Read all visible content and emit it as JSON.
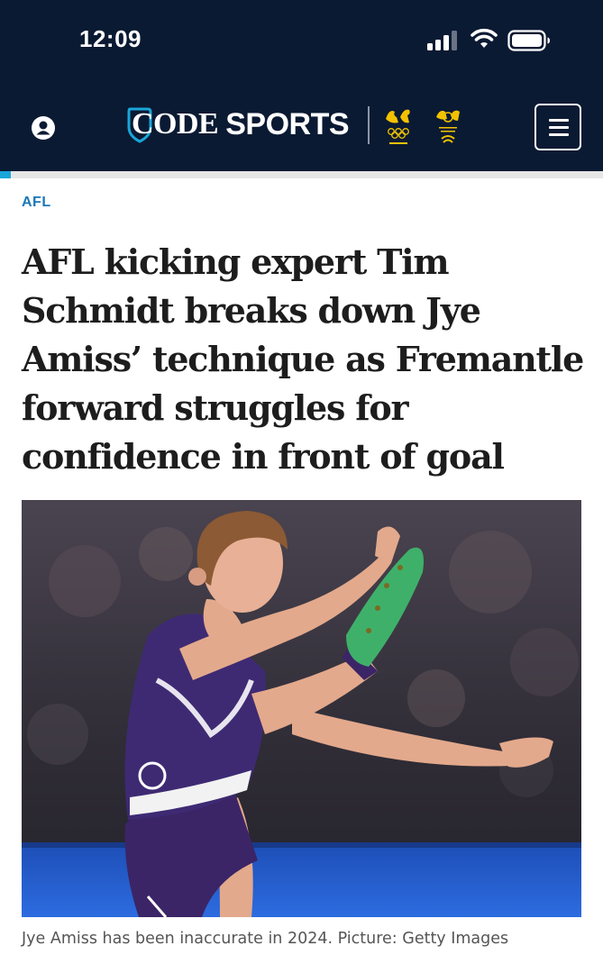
{
  "status_bar": {
    "time": "12:09",
    "icons": [
      "cellular-signal-icon",
      "wifi-icon",
      "battery-icon"
    ]
  },
  "header": {
    "logo_code": "CODE",
    "logo_sports": "SPORTS",
    "partner_logos": [
      "australian-olympic-team-logo",
      "paralympics-australia-logo"
    ],
    "colors": {
      "background": "#0b1a33",
      "accent": "#19a6d9"
    }
  },
  "article": {
    "category": "AFL",
    "headline": "AFL kicking expert Tim Schmidt breaks down Jye Amiss’ technique as Fremantle forward struggles for confidence in front of goal",
    "image_caption": "Jye Amiss has been inaccurate in 2024. Picture: Getty Images"
  }
}
